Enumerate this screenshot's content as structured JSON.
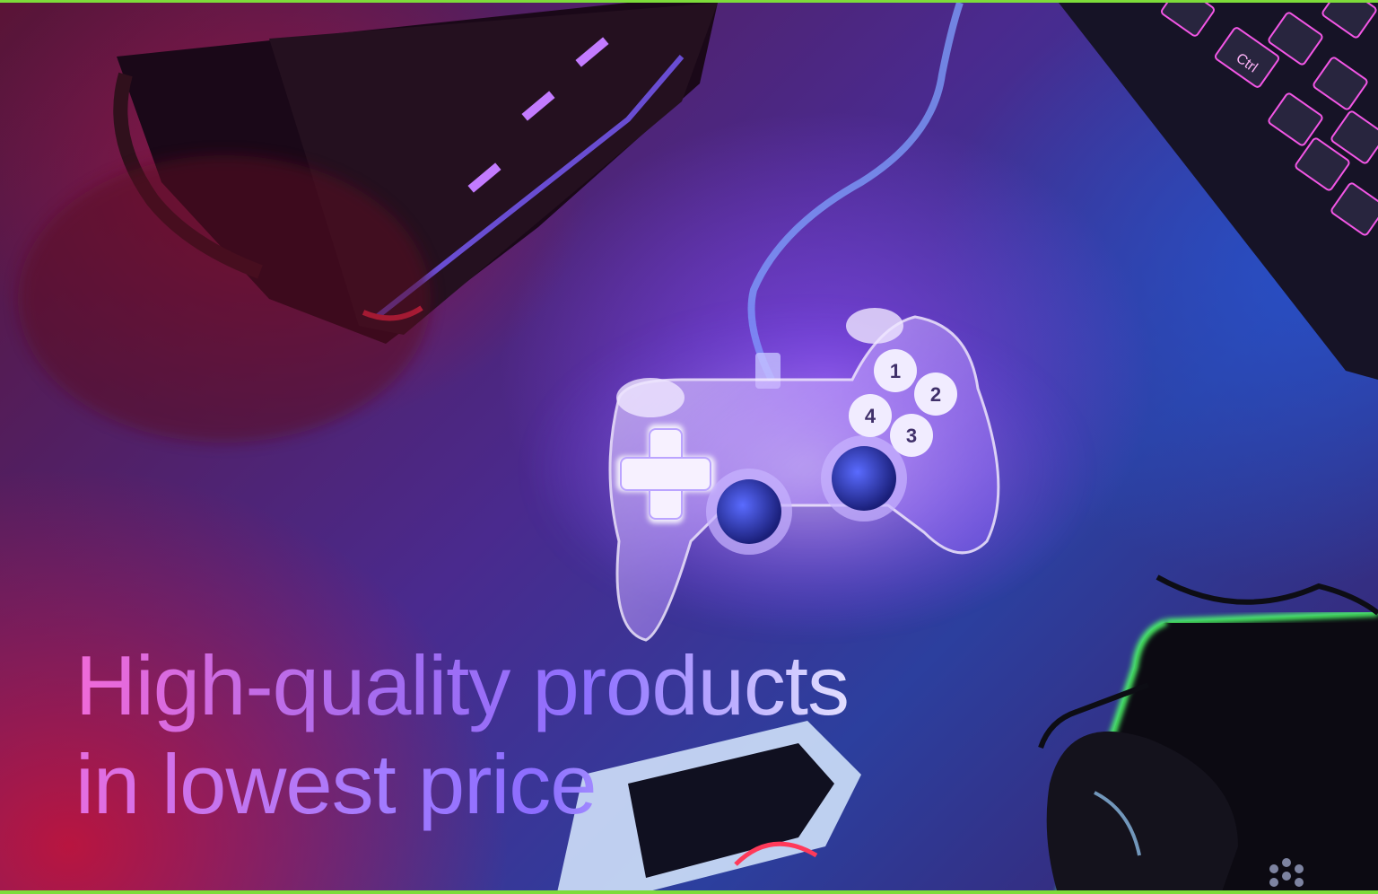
{
  "hero": {
    "headline_line1": "High-quality products",
    "headline_line2": "in lowest price"
  },
  "gamepad": {
    "face_buttons": [
      "1",
      "2",
      "3",
      "4"
    ]
  },
  "keyboard": {
    "key_ctrl": "Ctrl"
  },
  "colors": {
    "accent_border": "#7ddc3a",
    "mousepad_glow": "#4dff6a",
    "headline_start": "#f06ad8",
    "headline_mid": "#8e70ff",
    "headline_end": "#ffffff"
  },
  "icons": {
    "gamepad": "gamepad-icon",
    "keyboard": "keyboard-icon",
    "mouse": "mouse-icon",
    "vr_headset": "vr-headset-icon"
  }
}
